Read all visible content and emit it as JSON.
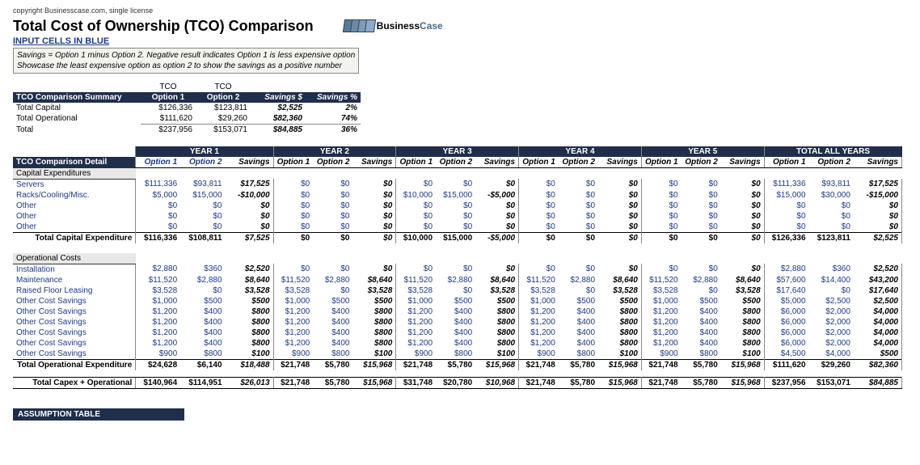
{
  "meta": {
    "copyright": "copyright Businesscase.com, single license"
  },
  "header": {
    "title": "Total Cost of Ownership (TCO) Comparison",
    "input_note": "INPUT CELLS IN BLUE",
    "logo_business": "Business",
    "logo_case": "Case",
    "savings_line1": "Savings = Option 1 minus Option 2.  Negative result indicates Option 1 is less expensive option",
    "savings_line2": "Showcase the least expensive option as option 2 to show the savings as a positive number"
  },
  "summary": {
    "title": "TCO Comparison Summary",
    "col_tco": "TCO",
    "col_opt1": "Option 1",
    "col_opt2": "Option 2",
    "col_sav_d": "Savings $",
    "col_sav_p": "Savings %",
    "rows": [
      {
        "label": "Total Capital",
        "opt1": "$126,336",
        "opt2": "$123,811",
        "savd": "$2,525",
        "savp": "2%"
      },
      {
        "label": "Total Operational",
        "opt1": "$111,620",
        "opt2": "$29,260",
        "savd": "$82,360",
        "savp": "74%"
      },
      {
        "label": "Total",
        "opt1": "$237,956",
        "opt2": "$153,071",
        "savd": "$84,885",
        "savp": "36%"
      }
    ]
  },
  "detail": {
    "title": "TCO Comparison Detail",
    "year_labels": [
      "YEAR 1",
      "YEAR 2",
      "YEAR 3",
      "YEAR 4",
      "YEAR 5",
      "TOTAL ALL YEARS"
    ],
    "col_opt1": "Option 1",
    "col_opt2": "Option 2",
    "col_sav": "Savings",
    "cap_header": "Capital Expenditures",
    "cap_rows": [
      {
        "label": "Servers",
        "y": [
          [
            "$111,336",
            "$93,811",
            "$17,525"
          ],
          [
            "$0",
            "$0",
            "$0"
          ],
          [
            "$0",
            "$0",
            "$0"
          ],
          [
            "$0",
            "$0",
            "$0"
          ],
          [
            "$0",
            "$0",
            "$0"
          ],
          [
            "$111,336",
            "$93,811",
            "$17,525"
          ]
        ]
      },
      {
        "label": "Racks/Cooling/Misc.",
        "y": [
          [
            "$5,000",
            "$15,000",
            "-$10,000"
          ],
          [
            "$0",
            "$0",
            "$0"
          ],
          [
            "$10,000",
            "$15,000",
            "-$5,000"
          ],
          [
            "$0",
            "$0",
            "$0"
          ],
          [
            "$0",
            "$0",
            "$0"
          ],
          [
            "$15,000",
            "$30,000",
            "-$15,000"
          ]
        ]
      },
      {
        "label": "Other",
        "y": [
          [
            "$0",
            "$0",
            "$0"
          ],
          [
            "$0",
            "$0",
            "$0"
          ],
          [
            "$0",
            "$0",
            "$0"
          ],
          [
            "$0",
            "$0",
            "$0"
          ],
          [
            "$0",
            "$0",
            "$0"
          ],
          [
            "$0",
            "$0",
            "$0"
          ]
        ]
      },
      {
        "label": "Other",
        "y": [
          [
            "$0",
            "$0",
            "$0"
          ],
          [
            "$0",
            "$0",
            "$0"
          ],
          [
            "$0",
            "$0",
            "$0"
          ],
          [
            "$0",
            "$0",
            "$0"
          ],
          [
            "$0",
            "$0",
            "$0"
          ],
          [
            "$0",
            "$0",
            "$0"
          ]
        ]
      },
      {
        "label": "Other",
        "y": [
          [
            "$0",
            "$0",
            "$0"
          ],
          [
            "$0",
            "$0",
            "$0"
          ],
          [
            "$0",
            "$0",
            "$0"
          ],
          [
            "$0",
            "$0",
            "$0"
          ],
          [
            "$0",
            "$0",
            "$0"
          ],
          [
            "$0",
            "$0",
            "$0"
          ]
        ]
      }
    ],
    "cap_total": {
      "label": "Total Capital Expenditure",
      "y": [
        [
          "$116,336",
          "$108,811",
          "$7,525"
        ],
        [
          "$0",
          "$0",
          "$0"
        ],
        [
          "$10,000",
          "$15,000",
          "-$5,000"
        ],
        [
          "$0",
          "$0",
          "$0"
        ],
        [
          "$0",
          "$0",
          "$0"
        ],
        [
          "$126,336",
          "$123,811",
          "$2,525"
        ]
      ]
    },
    "op_header": "Operational Costs",
    "op_rows": [
      {
        "label": "Installation",
        "y": [
          [
            "$2,880",
            "$360",
            "$2,520"
          ],
          [
            "$0",
            "$0",
            "$0"
          ],
          [
            "$0",
            "$0",
            "$0"
          ],
          [
            "$0",
            "$0",
            "$0"
          ],
          [
            "$0",
            "$0",
            "$0"
          ],
          [
            "$2,880",
            "$360",
            "$2,520"
          ]
        ]
      },
      {
        "label": "Maintenance",
        "y": [
          [
            "$11,520",
            "$2,880",
            "$8,640"
          ],
          [
            "$11,520",
            "$2,880",
            "$8,640"
          ],
          [
            "$11,520",
            "$2,880",
            "$8,640"
          ],
          [
            "$11,520",
            "$2,880",
            "$8,640"
          ],
          [
            "$11,520",
            "$2,880",
            "$8,640"
          ],
          [
            "$57,600",
            "$14,400",
            "$43,200"
          ]
        ]
      },
      {
        "label": "Raised Floor Leasing",
        "y": [
          [
            "$3,528",
            "$0",
            "$3,528"
          ],
          [
            "$3,528",
            "$0",
            "$3,528"
          ],
          [
            "$3,528",
            "$0",
            "$3,528"
          ],
          [
            "$3,528",
            "$0",
            "$3,528"
          ],
          [
            "$3,528",
            "$0",
            "$3,528"
          ],
          [
            "$17,640",
            "$0",
            "$17,640"
          ]
        ]
      },
      {
        "label": "Other Cost Savings",
        "y": [
          [
            "$1,000",
            "$500",
            "$500"
          ],
          [
            "$1,000",
            "$500",
            "$500"
          ],
          [
            "$1,000",
            "$500",
            "$500"
          ],
          [
            "$1,000",
            "$500",
            "$500"
          ],
          [
            "$1,000",
            "$500",
            "$500"
          ],
          [
            "$5,000",
            "$2,500",
            "$2,500"
          ]
        ]
      },
      {
        "label": "Other Cost Savings",
        "y": [
          [
            "$1,200",
            "$400",
            "$800"
          ],
          [
            "$1,200",
            "$400",
            "$800"
          ],
          [
            "$1,200",
            "$400",
            "$800"
          ],
          [
            "$1,200",
            "$400",
            "$800"
          ],
          [
            "$1,200",
            "$400",
            "$800"
          ],
          [
            "$6,000",
            "$2,000",
            "$4,000"
          ]
        ]
      },
      {
        "label": "Other Cost Savings",
        "y": [
          [
            "$1,200",
            "$400",
            "$800"
          ],
          [
            "$1,200",
            "$400",
            "$800"
          ],
          [
            "$1,200",
            "$400",
            "$800"
          ],
          [
            "$1,200",
            "$400",
            "$800"
          ],
          [
            "$1,200",
            "$400",
            "$800"
          ],
          [
            "$6,000",
            "$2,000",
            "$4,000"
          ]
        ]
      },
      {
        "label": "Other Cost Savings",
        "y": [
          [
            "$1,200",
            "$400",
            "$800"
          ],
          [
            "$1,200",
            "$400",
            "$800"
          ],
          [
            "$1,200",
            "$400",
            "$800"
          ],
          [
            "$1,200",
            "$400",
            "$800"
          ],
          [
            "$1,200",
            "$400",
            "$800"
          ],
          [
            "$6,000",
            "$2,000",
            "$4,000"
          ]
        ]
      },
      {
        "label": "Other Cost Savings",
        "y": [
          [
            "$1,200",
            "$400",
            "$800"
          ],
          [
            "$1,200",
            "$400",
            "$800"
          ],
          [
            "$1,200",
            "$400",
            "$800"
          ],
          [
            "$1,200",
            "$400",
            "$800"
          ],
          [
            "$1,200",
            "$400",
            "$800"
          ],
          [
            "$6,000",
            "$2,000",
            "$4,000"
          ]
        ]
      },
      {
        "label": "Other Cost Savings",
        "y": [
          [
            "$900",
            "$800",
            "$100"
          ],
          [
            "$900",
            "$800",
            "$100"
          ],
          [
            "$900",
            "$800",
            "$100"
          ],
          [
            "$900",
            "$800",
            "$100"
          ],
          [
            "$900",
            "$800",
            "$100"
          ],
          [
            "$4,500",
            "$4,000",
            "$500"
          ]
        ]
      }
    ],
    "op_total": {
      "label": "Total Operational Expenditure",
      "y": [
        [
          "$24,628",
          "$6,140",
          "$18,488"
        ],
        [
          "$21,748",
          "$5,780",
          "$15,968"
        ],
        [
          "$21,748",
          "$5,780",
          "$15,968"
        ],
        [
          "$21,748",
          "$5,780",
          "$15,968"
        ],
        [
          "$21,748",
          "$5,780",
          "$15,968"
        ],
        [
          "$111,620",
          "$29,260",
          "$82,360"
        ]
      ]
    },
    "grand_total": {
      "label": "Total Capex + Operational",
      "y": [
        [
          "$140,964",
          "$114,951",
          "$26,013"
        ],
        [
          "$21,748",
          "$5,780",
          "$15,968"
        ],
        [
          "$31,748",
          "$20,780",
          "$10,968"
        ],
        [
          "$21,748",
          "$5,780",
          "$15,968"
        ],
        [
          "$21,748",
          "$5,780",
          "$15,968"
        ],
        [
          "$237,956",
          "$153,071",
          "$84,885"
        ]
      ]
    }
  },
  "assumption": {
    "title": "ASSUMPTION TABLE"
  }
}
